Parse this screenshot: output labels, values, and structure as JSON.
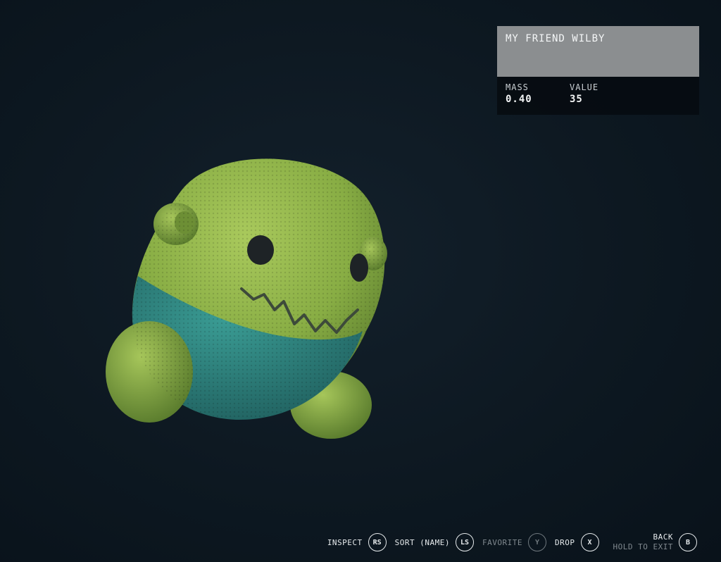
{
  "item": {
    "name": "MY FRIEND WILBY",
    "stats": [
      {
        "label": "MASS",
        "value": "0.40"
      },
      {
        "label": "VALUE",
        "value": "35"
      }
    ]
  },
  "prompts": [
    {
      "label": "INSPECT",
      "button": "RS",
      "enabled": true
    },
    {
      "label": "SORT (NAME)",
      "button": "LS",
      "enabled": true
    },
    {
      "label": "FAVORITE",
      "button": "Y",
      "enabled": false
    },
    {
      "label": "DROP",
      "button": "X",
      "enabled": true
    }
  ],
  "back": {
    "label": "BACK",
    "sub": "HOLD TO EXIT",
    "button": "B"
  },
  "colors": {
    "plush_green": "#93b94a",
    "plush_teal": "#2f8a86",
    "background": "#0d1821"
  },
  "icons": [
    "plush-toy-model"
  ]
}
